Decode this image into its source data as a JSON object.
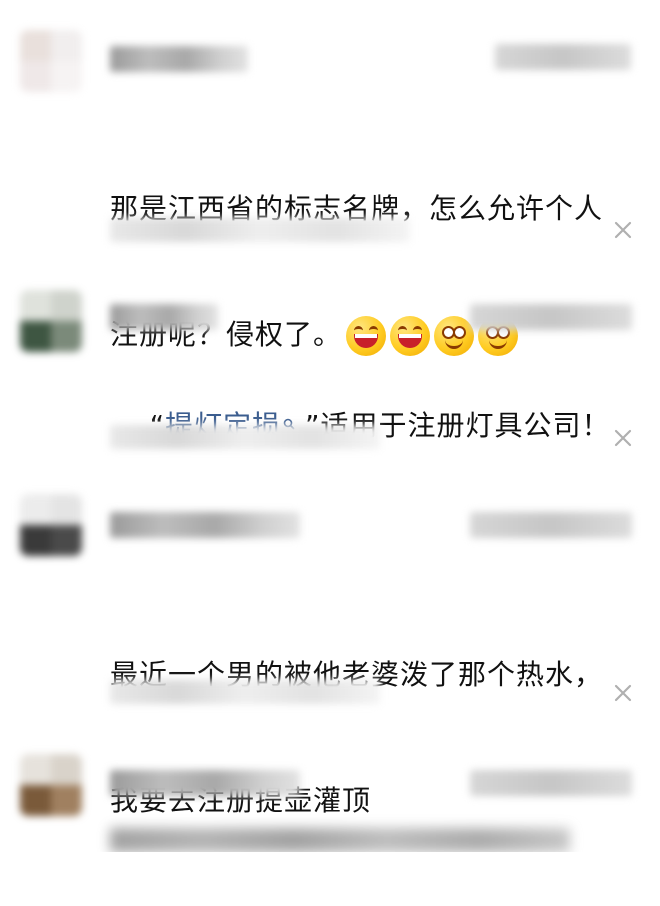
{
  "comments": [
    {
      "lines": [
        "那是江西省的标志名牌，怎么允许个人",
        "注册呢？侵权了。"
      ],
      "emojis": [
        "grinning-squint-emoji",
        "grinning-squint-emoji",
        "sly-smile-emoji",
        "sly-smile-emoji"
      ]
    },
    {
      "quote_open": "“",
      "link_text": "提灯定损",
      "quote_close": " ”",
      "rest": "适用于注册灯具公司！"
    },
    {
      "lines": [
        "最近一个男的被他老婆泼了那个热水，",
        "我要去注册提壶灌顶"
      ]
    }
  ],
  "colors": {
    "link": "#3b5d8f",
    "close_icon": "#b0b0b0"
  },
  "icons": {
    "close": "close-icon",
    "search_mark": "search-icon"
  }
}
